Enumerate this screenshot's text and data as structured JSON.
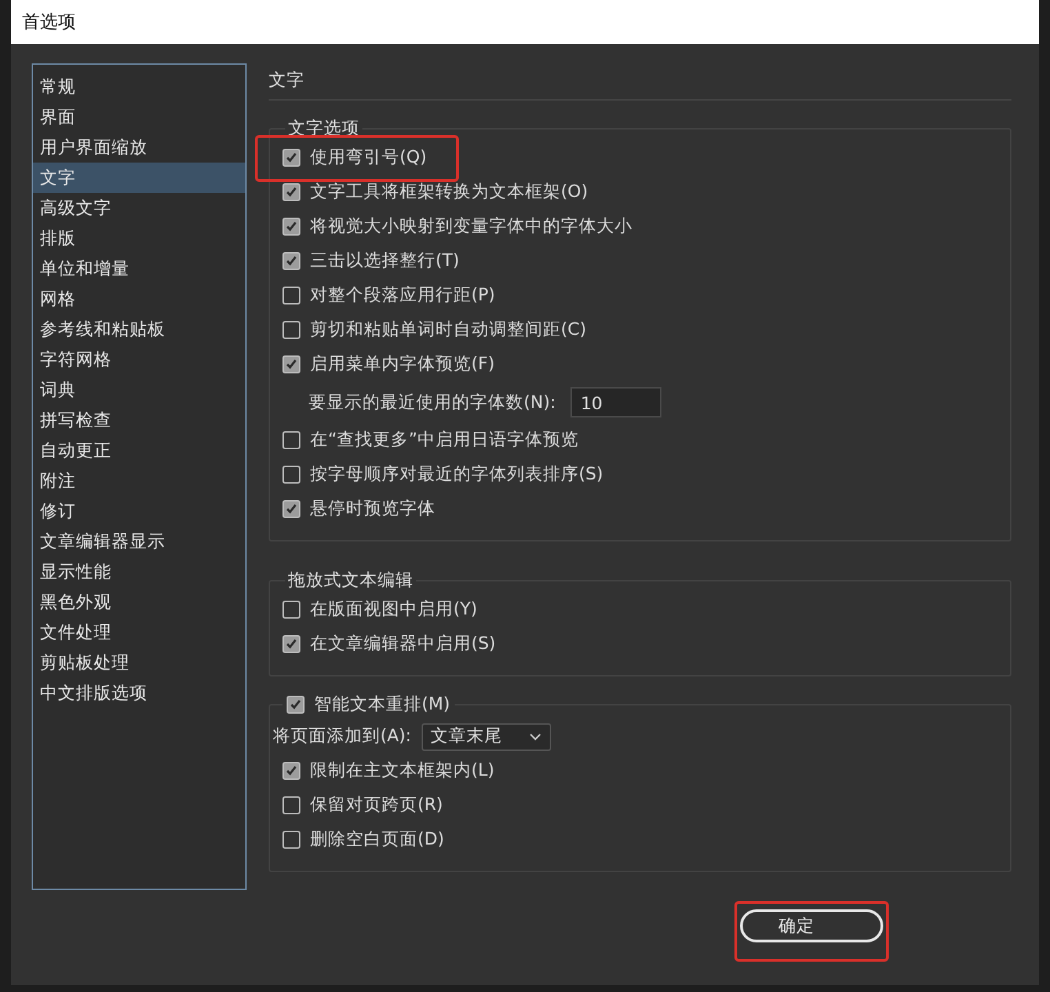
{
  "window": {
    "title": "首选项"
  },
  "sidebar": {
    "items": [
      {
        "label": "常规",
        "selected": false
      },
      {
        "label": "界面",
        "selected": false
      },
      {
        "label": "用户界面缩放",
        "selected": false
      },
      {
        "label": "文字",
        "selected": true
      },
      {
        "label": "高级文字",
        "selected": false
      },
      {
        "label": "排版",
        "selected": false
      },
      {
        "label": "单位和增量",
        "selected": false
      },
      {
        "label": "网格",
        "selected": false
      },
      {
        "label": "参考线和粘贴板",
        "selected": false
      },
      {
        "label": "字符网格",
        "selected": false
      },
      {
        "label": "词典",
        "selected": false
      },
      {
        "label": "拼写检查",
        "selected": false
      },
      {
        "label": "自动更正",
        "selected": false
      },
      {
        "label": "附注",
        "selected": false
      },
      {
        "label": "修订",
        "selected": false
      },
      {
        "label": "文章编辑器显示",
        "selected": false
      },
      {
        "label": "显示性能",
        "selected": false
      },
      {
        "label": "黑色外观",
        "selected": false
      },
      {
        "label": "文件处理",
        "selected": false
      },
      {
        "label": "剪贴板处理",
        "selected": false
      },
      {
        "label": "中文排版选项",
        "selected": false
      }
    ]
  },
  "heading": "文字",
  "groups": [
    {
      "legend": "文字选项",
      "rows": [
        {
          "kind": "checkbox",
          "label": "使用弯引号(Q)",
          "checked": true,
          "highlighted": true
        },
        {
          "kind": "checkbox",
          "label": "文字工具将框架转换为文本框架(O)",
          "checked": true
        },
        {
          "kind": "checkbox",
          "label": "将视觉大小映射到变量字体中的字体大小",
          "checked": true
        },
        {
          "kind": "checkbox",
          "label": "三击以选择整行(T)",
          "checked": true
        },
        {
          "kind": "checkbox",
          "label": "对整个段落应用行距(P)",
          "checked": false
        },
        {
          "kind": "checkbox",
          "label": "剪切和粘贴单词时自动调整间距(C)",
          "checked": false
        },
        {
          "kind": "checkbox",
          "label": "启用菜单内字体预览(F)",
          "checked": true
        },
        {
          "kind": "number",
          "label": "要显示的最近使用的字体数(N):",
          "value": "10"
        },
        {
          "kind": "checkbox",
          "label": "在“查找更多”中启用日语字体预览",
          "checked": false
        },
        {
          "kind": "checkbox",
          "label": "按字母顺序对最近的字体列表排序(S)",
          "checked": false
        },
        {
          "kind": "checkbox",
          "label": "悬停时预览字体",
          "checked": true
        }
      ]
    },
    {
      "legend": "拖放式文本编辑",
      "rows": [
        {
          "kind": "checkbox",
          "label": "在版面视图中启用(Y)",
          "checked": false
        },
        {
          "kind": "checkbox",
          "label": "在文章编辑器中启用(S)",
          "checked": true
        }
      ]
    },
    {
      "legend": "智能文本重排(M)",
      "legend_checked": true,
      "rows": [
        {
          "kind": "select",
          "label": "将页面添加到(A):",
          "value": "文章末尾"
        },
        {
          "kind": "checkbox",
          "label": "限制在主文本框架内(L)",
          "checked": true
        },
        {
          "kind": "checkbox",
          "label": "保留对页跨页(R)",
          "checked": false
        },
        {
          "kind": "checkbox",
          "label": "删除空白页面(D)",
          "checked": false
        }
      ]
    }
  ],
  "buttons": [
    {
      "label": "确定",
      "highlighted": true
    }
  ]
}
